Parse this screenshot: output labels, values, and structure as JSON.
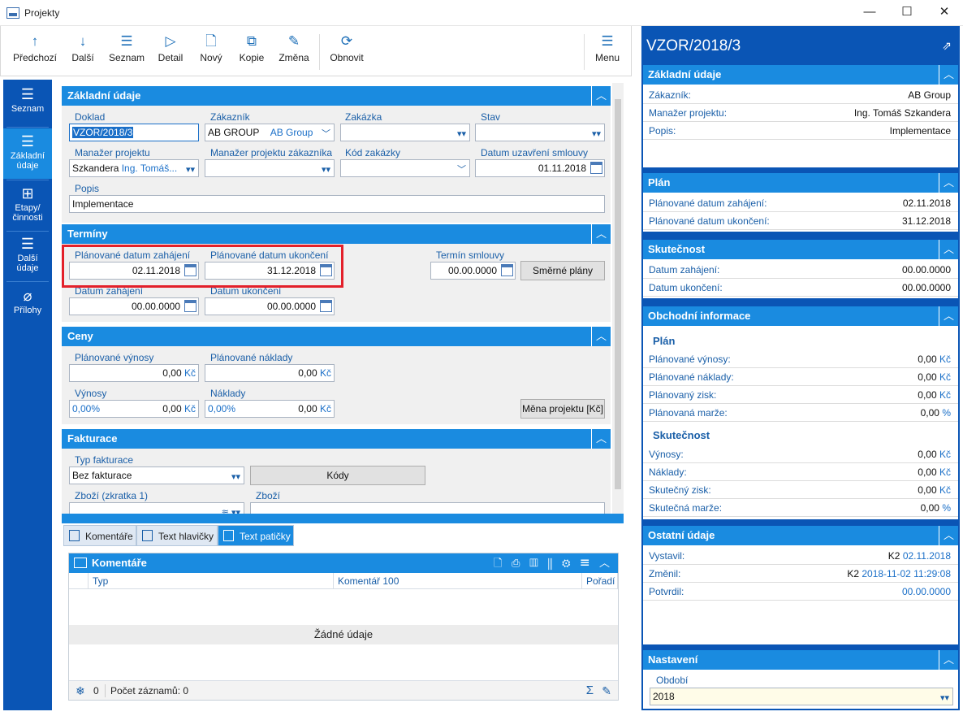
{
  "window": {
    "title": "Projekty",
    "minimize": "—",
    "maximize": "☐",
    "close": "✕"
  },
  "toolbar": {
    "items": [
      {
        "label": "Předchozí",
        "icon": "↑"
      },
      {
        "label": "Další",
        "icon": "↓"
      },
      {
        "label": "Seznam",
        "icon": "☰"
      },
      {
        "label": "Detail",
        "icon": "▷"
      },
      {
        "label": "Nový",
        "icon": "🗋"
      },
      {
        "label": "Kopie",
        "icon": "⧉"
      },
      {
        "label": "Změna",
        "icon": "✎"
      },
      {
        "label": "Obnovit",
        "icon": "⟳"
      }
    ],
    "menu": {
      "label": "Menu",
      "icon": "☰"
    }
  },
  "leftnav": [
    {
      "label1": "Seznam",
      "label2": "",
      "icon": "☰"
    },
    {
      "label1": "Základní",
      "label2": "údaje",
      "icon": "☰"
    },
    {
      "label1": "Etapy/",
      "label2": "činnosti",
      "icon": "⊞"
    },
    {
      "label1": "Další",
      "label2": "údaje",
      "icon": "☰"
    },
    {
      "label1": "Přílohy",
      "label2": "",
      "icon": "⌀"
    }
  ],
  "basic": {
    "title": "Základní údaje",
    "doklad_label": "Doklad",
    "doklad_value": "VZOR/2018/3",
    "zakaznik_label": "Zákazník",
    "zakaznik_value": "AB GROUP",
    "zakaznik_name": "AB Group",
    "zakazka_label": "Zakázka",
    "stav_label": "Stav",
    "manazer_label": "Manažer projektu",
    "manazer_value": "Szkandera",
    "manazer_name": "Ing. Tomáš...",
    "manazer_zak_label": "Manažer projektu zákazníka",
    "kod_label": "Kód zakázky",
    "datum_smlouvy_label": "Datum uzavření smlouvy",
    "datum_smlouvy_value": "01.11.2018",
    "popis_label": "Popis",
    "popis_value": "Implementace"
  },
  "terms": {
    "title": "Termíny",
    "plan_start_label": "Plánované datum zahájení",
    "plan_start_value": "02.11.2018",
    "plan_end_label": "Plánované datum ukončení",
    "plan_end_value": "31.12.2018",
    "start_label": "Datum zahájení",
    "start_value": "00.00.0000",
    "end_label": "Datum ukončení",
    "end_value": "00.00.0000",
    "contract_label": "Termín smlouvy",
    "contract_value": "00.00.0000",
    "plans_button": "Směrné plány"
  },
  "prices": {
    "title": "Ceny",
    "plan_rev_label": "Plánované výnosy",
    "plan_rev_value": "0,00",
    "currency": "Kč",
    "plan_cost_label": "Plánované náklady",
    "plan_cost_value": "0,00",
    "rev_label": "Výnosy",
    "rev_pct": "0,00%",
    "rev_value": "0,00",
    "cost_label": "Náklady",
    "cost_pct": "0,00%",
    "cost_value": "0,00",
    "currency_button": "Měna projektu [Kč]"
  },
  "billing": {
    "title": "Fakturace",
    "type_label": "Typ fakturace",
    "type_value": "Bez fakturace",
    "codes_button": "Kódy",
    "goods_short_label": "Zboží (zkratka 1)",
    "goods_label": "Zboží"
  },
  "tabs": [
    {
      "label": "Komentáře"
    },
    {
      "label": "Text hlavičky"
    },
    {
      "label": "Text patičky"
    }
  ],
  "grid": {
    "title": "Komentáře",
    "columns": [
      "Typ",
      "Komentář 100",
      "Pořadí"
    ],
    "empty": "Žádné údaje",
    "count_value": "0",
    "records_label": "Počet záznamů: 0"
  },
  "right": {
    "title": "VZOR/2018/3",
    "basic": {
      "title": "Základní údaje",
      "rows": [
        {
          "k": "Zákazník:",
          "v": "AB Group"
        },
        {
          "k": "Manažer projektu:",
          "v": "Ing. Tomáš Szkandera"
        },
        {
          "k": "Popis:",
          "v": "Implementace"
        }
      ]
    },
    "plan": {
      "title": "Plán",
      "rows": [
        {
          "k": "Plánované datum zahájení:",
          "v": "02.11.2018"
        },
        {
          "k": "Plánované datum ukončení:",
          "v": "31.12.2018"
        }
      ]
    },
    "actual": {
      "title": "Skutečnost",
      "rows": [
        {
          "k": "Datum zahájení:",
          "v": "00.00.0000"
        },
        {
          "k": "Datum ukončení:",
          "v": "00.00.0000"
        }
      ]
    },
    "business": {
      "title": "Obchodní informace",
      "plan_sub": "Plán",
      "plan_rows": [
        {
          "k": "Plánované výnosy:",
          "v": "0,00",
          "u": "Kč"
        },
        {
          "k": "Plánované náklady:",
          "v": "0,00",
          "u": "Kč"
        },
        {
          "k": "Plánovaný zisk:",
          "v": "0,00",
          "u": "Kč"
        },
        {
          "k": "Plánovaná marže:",
          "v": "0,00",
          "u": "%"
        }
      ],
      "actual_sub": "Skutečnost",
      "actual_rows": [
        {
          "k": "Výnosy:",
          "v": "0,00",
          "u": "Kč"
        },
        {
          "k": "Náklady:",
          "v": "0,00",
          "u": "Kč"
        },
        {
          "k": "Skutečný zisk:",
          "v": "0,00",
          "u": "Kč"
        },
        {
          "k": "Skutečná marže:",
          "v": "0,00",
          "u": "%"
        }
      ]
    },
    "other": {
      "title": "Ostatní údaje",
      "rows": [
        {
          "k": "Vystavil:",
          "p": "K2",
          "v": "02.11.2018"
        },
        {
          "k": "Změnil:",
          "p": "K2",
          "v": "2018-11-02 11:29:08"
        },
        {
          "k": "Potvrdil:",
          "p": "",
          "v": "00.00.0000"
        }
      ]
    },
    "settings": {
      "title": "Nastavení",
      "period_label": "Období",
      "period_value": "2018"
    }
  }
}
